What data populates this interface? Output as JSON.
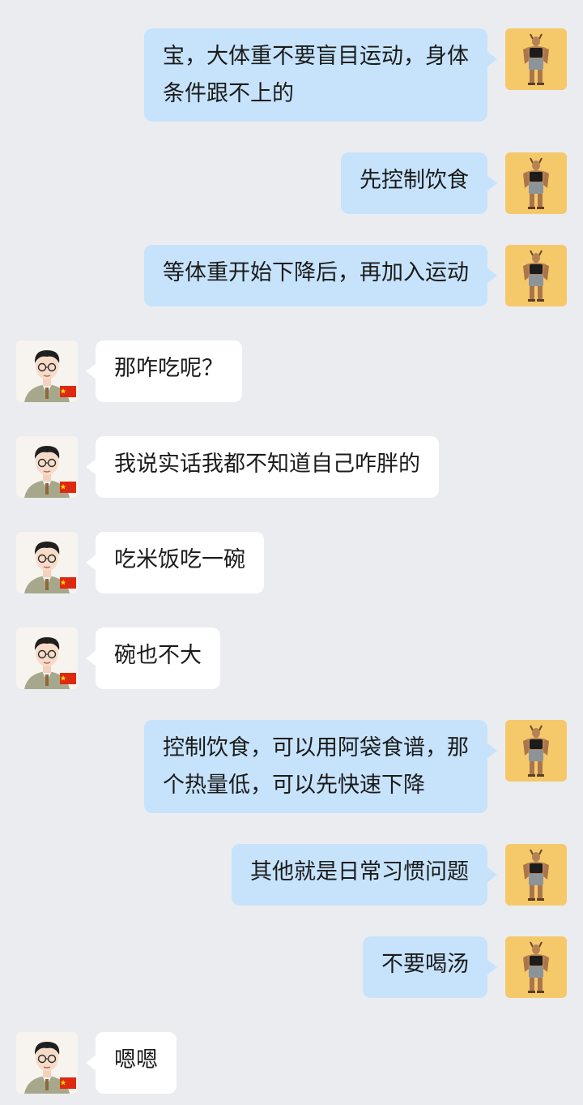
{
  "conversation": {
    "colors": {
      "background": "#ebecf0",
      "outgoing_bubble": "#c6e3fb",
      "incoming_bubble": "#ffffff",
      "outgoing_avatar_bg": "#f5c96a"
    },
    "messages": [
      {
        "side": "right",
        "text": "宝，大体重不要盲目运动，身体\n条件跟不上的"
      },
      {
        "side": "right",
        "text": "先控制饮食"
      },
      {
        "side": "right",
        "text": "等体重开始下降后，再加入运动"
      },
      {
        "side": "left",
        "text": "那咋吃呢？"
      },
      {
        "side": "left",
        "text": "我说实话我都不知道自己咋胖的"
      },
      {
        "side": "left",
        "text": "吃米饭吃一碗"
      },
      {
        "side": "left",
        "text": "碗也不大"
      },
      {
        "side": "right",
        "text": "控制饮食，可以用阿袋食谱，那\n个热量低，可以先快速下降"
      },
      {
        "side": "right",
        "text": "其他就是日常习惯问题"
      },
      {
        "side": "right",
        "text": "不要喝汤"
      },
      {
        "side": "left",
        "text": "嗯嗯"
      }
    ]
  }
}
